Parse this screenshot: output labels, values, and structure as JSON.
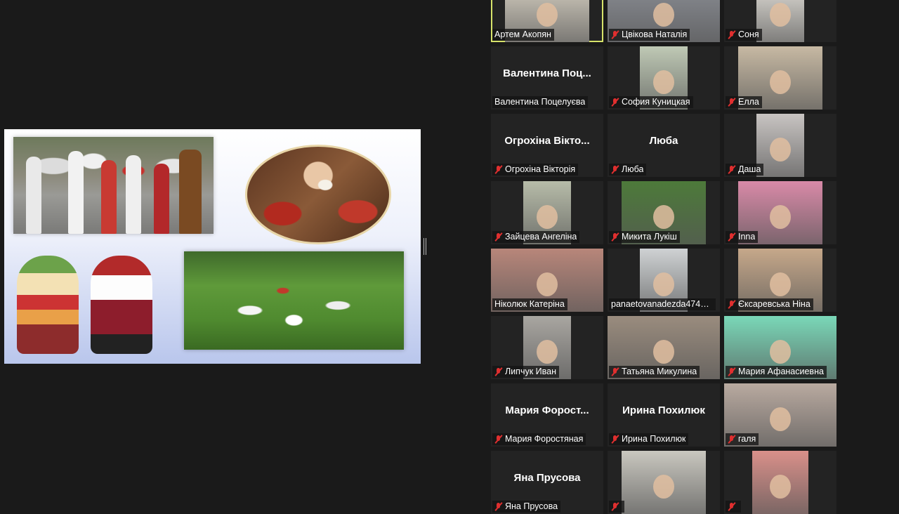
{
  "slide": {
    "images": [
      "folk-musicians-photo",
      "pysanka-egg-painting-photo",
      "motanka-dolls-photo",
      "circle-dance-photo"
    ]
  },
  "participants": [
    {
      "name": "Артем Акопян",
      "big": "",
      "muted": false,
      "active": true,
      "video": "#d9d2c4",
      "vl": 20,
      "vw": 120
    },
    {
      "name": "Цвікова Наталія",
      "big": "",
      "muted": true,
      "active": false,
      "video": "#8c8f96",
      "vl": 0,
      "vw": 160
    },
    {
      "name": "Соня",
      "big": "",
      "muted": true,
      "active": false,
      "video": "#e6e3dc",
      "vl": 46,
      "vw": 68
    },
    {
      "name": "Валентина Поцелуєва",
      "big": "Валентина  Поц...",
      "muted": false,
      "active": false,
      "video": "",
      "vl": 0,
      "vw": 0
    },
    {
      "name": "София Куницкая",
      "big": "",
      "muted": true,
      "active": false,
      "video": "#bfc9b5",
      "vl": 46,
      "vw": 68
    },
    {
      "name": "Елла",
      "big": "",
      "muted": true,
      "active": false,
      "video": "#c7b9a3",
      "vl": 20,
      "vw": 120
    },
    {
      "name": "Огрохіна Вікторія",
      "big": "Огрохіна Вікто...",
      "muted": true,
      "active": false,
      "video": "",
      "vl": 0,
      "vw": 0
    },
    {
      "name": "Люба",
      "big": "Люба",
      "muted": true,
      "active": false,
      "video": "",
      "vl": 0,
      "vw": 0
    },
    {
      "name": "Даша",
      "big": "",
      "muted": true,
      "active": false,
      "video": "#c8c4c2",
      "vl": 46,
      "vw": 68
    },
    {
      "name": "Зайцева Ангеліна",
      "big": "",
      "muted": true,
      "active": false,
      "video": "#b7bca9",
      "vl": 46,
      "vw": 68
    },
    {
      "name": "Микита Лукіш",
      "big": "",
      "muted": true,
      "active": false,
      "video": "#4d7a3a",
      "vl": 20,
      "vw": 120
    },
    {
      "name": "Inna",
      "big": "",
      "muted": true,
      "active": false,
      "video": "#d98aa8",
      "vl": 20,
      "vw": 120
    },
    {
      "name": "Ніколюк Катеріна",
      "big": "",
      "muted": false,
      "active": false,
      "video": "#b8867a",
      "vl": 0,
      "vw": 160
    },
    {
      "name": "panaetovanadezda474@...",
      "big": "",
      "muted": false,
      "active": false,
      "video": "#cfd2d4",
      "vl": 46,
      "vw": 68
    },
    {
      "name": "Єксаревська Ніна",
      "big": "",
      "muted": true,
      "active": false,
      "video": "#c6a88a",
      "vl": 20,
      "vw": 120
    },
    {
      "name": "Липчук Иван",
      "big": "",
      "muted": true,
      "active": false,
      "video": "#a9a6a1",
      "vl": 46,
      "vw": 68
    },
    {
      "name": "Татьяна Микулина",
      "big": "",
      "muted": true,
      "active": false,
      "video": "#9a8c7e",
      "vl": 0,
      "vw": 160
    },
    {
      "name": "Мария Афанасиевна",
      "big": "",
      "muted": true,
      "active": false,
      "video": "#7ad8b8",
      "vl": 0,
      "vw": 160
    },
    {
      "name": "Мария Форостяная",
      "big": "Мария  Форост...",
      "muted": true,
      "active": false,
      "video": "",
      "vl": 0,
      "vw": 0
    },
    {
      "name": "Ирина Похилюк",
      "big": "Ирина Похилюк",
      "muted": true,
      "active": false,
      "video": "",
      "vl": 0,
      "vw": 0
    },
    {
      "name": "галя",
      "big": "",
      "muted": true,
      "active": false,
      "video": "#b9aaa0",
      "vl": 0,
      "vw": 160
    },
    {
      "name": "Яна Прусова",
      "big": "Яна Прусова",
      "muted": true,
      "active": false,
      "video": "",
      "vl": 0,
      "vw": 0
    },
    {
      "name": "",
      "big": "",
      "muted": true,
      "active": false,
      "video": "#c9c7bf",
      "vl": 20,
      "vw": 120
    },
    {
      "name": "",
      "big": "",
      "muted": true,
      "active": false,
      "video": "#d9908a",
      "vl": 40,
      "vw": 80
    }
  ]
}
